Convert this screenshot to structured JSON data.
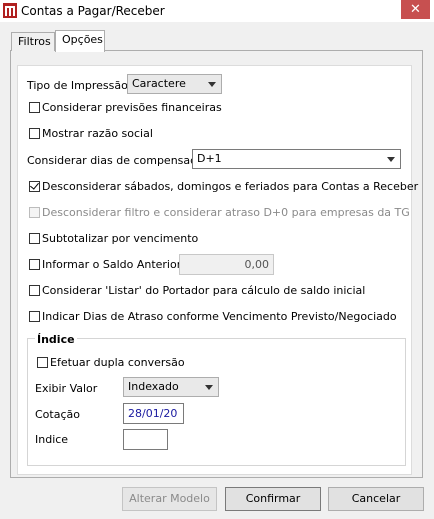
{
  "window": {
    "title": "Contas a Pagar/Receber",
    "close_glyph": "✕"
  },
  "tabs": [
    {
      "label": "Filtros"
    },
    {
      "label": "Opções"
    }
  ],
  "options": {
    "tipo_impressao": {
      "label": "Tipo de Impressão",
      "value": "Caractere"
    },
    "considerar_previsoes": {
      "label": "Considerar previsões financeiras",
      "checked": false
    },
    "mostrar_razao": {
      "label": "Mostrar razão social",
      "checked": false
    },
    "dias_compensacao": {
      "label": "Considerar dias de compensação",
      "value": "D+1"
    },
    "desconsiderar_sabados": {
      "label": "Desconsiderar sábados, domingos e feriados para Contas a Receber",
      "checked": true
    },
    "desconsiderar_filtro": {
      "label": "Desconsiderar filtro e considerar atraso D+0 para empresas da TG",
      "checked": false,
      "disabled": true
    },
    "subtotalizar": {
      "label": "Subtotalizar por vencimento",
      "checked": false
    },
    "saldo_anterior": {
      "label": "Informar o Saldo Anterior",
      "checked": false,
      "value": "0,00"
    },
    "considerar_listar": {
      "label": "Considerar 'Listar' do Portador para cálculo de saldo inicial",
      "checked": false
    },
    "indicar_dias_atraso": {
      "label": "Indicar Dias de Atraso conforme Vencimento Previsto/Negociado",
      "checked": false
    }
  },
  "indice": {
    "title": "Índice",
    "dupla_conversao": {
      "label": "Efetuar dupla conversão",
      "checked": false
    },
    "exibir_valor": {
      "label": "Exibir Valor",
      "value": "Indexado"
    },
    "cotacao": {
      "label": "Cotação",
      "value": "28/01/20"
    },
    "indice_field": {
      "label": "Indice",
      "value": ""
    }
  },
  "buttons": {
    "alterar": "Alterar Modelo",
    "confirmar": "Confirmar",
    "cancelar": "Cancelar"
  }
}
